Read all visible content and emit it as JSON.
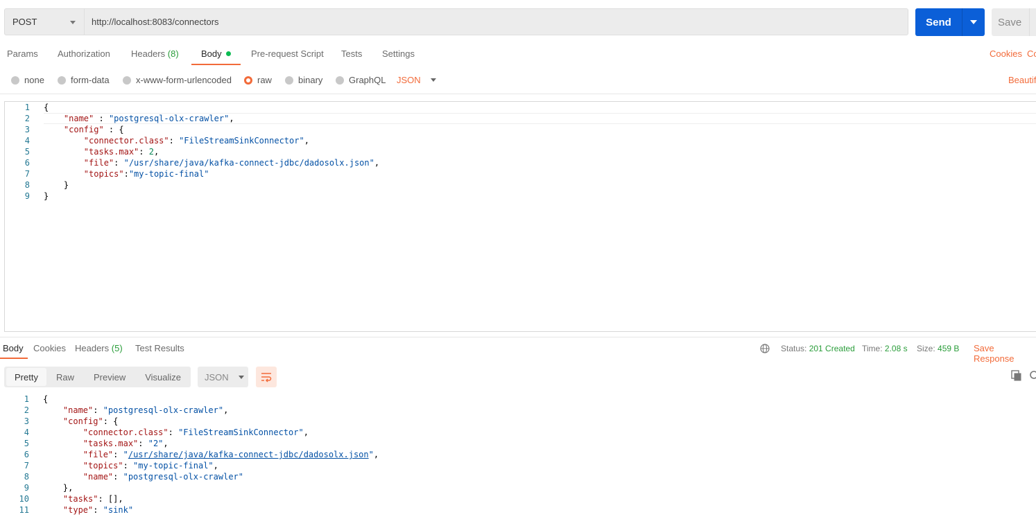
{
  "request": {
    "method": "POST",
    "url": "http://localhost:8083/connectors",
    "send_label": "Send",
    "save_label": "Save"
  },
  "request_tabs": {
    "params": "Params",
    "authorization": "Authorization",
    "headers": "Headers",
    "headers_count": "(8)",
    "body": "Body",
    "prerequest": "Pre-request Script",
    "tests": "Tests",
    "settings": "Settings",
    "cookies_link": "Cookies",
    "code_link": "Co"
  },
  "body_types": {
    "none": "none",
    "form_data": "form-data",
    "urlencoded": "x-www-form-urlencoded",
    "raw": "raw",
    "binary": "binary",
    "graphql": "GraphQL",
    "language": "JSON",
    "beautify": "Beautif"
  },
  "request_body_lines": [
    {
      "n": "1",
      "t": "{"
    },
    {
      "n": "2",
      "t": "    \"name\" : \"postgresql-olx-crawler\","
    },
    {
      "n": "3",
      "t": "    \"config\" : {"
    },
    {
      "n": "4",
      "t": "        \"connector.class\": \"FileStreamSinkConnector\","
    },
    {
      "n": "5",
      "t": "        \"tasks.max\": 2,"
    },
    {
      "n": "6",
      "t": "        \"file\": \"/usr/share/java/kafka-connect-jdbc/dadosolx.json\","
    },
    {
      "n": "7",
      "t": "        \"topics\":\"my-topic-final\""
    },
    {
      "n": "8",
      "t": "    }"
    },
    {
      "n": "9",
      "t": "}"
    }
  ],
  "response_tabs": {
    "body": "Body",
    "cookies": "Cookies",
    "headers": "Headers",
    "headers_count": "(5)",
    "test_results": "Test Results"
  },
  "response_meta": {
    "status_label": "Status:",
    "status_value": "201 Created",
    "time_label": "Time:",
    "time_value": "2.08 s",
    "size_label": "Size:",
    "size_value": "459 B",
    "save_response": "Save Response"
  },
  "response_view": {
    "pretty": "Pretty",
    "raw": "Raw",
    "preview": "Preview",
    "visualize": "Visualize",
    "format": "JSON"
  },
  "response_body_lines": [
    {
      "n": "1",
      "t": "{"
    },
    {
      "n": "2",
      "t": "    \"name\": \"postgresql-olx-crawler\","
    },
    {
      "n": "3",
      "t": "    \"config\": {"
    },
    {
      "n": "4",
      "t": "        \"connector.class\": \"FileStreamSinkConnector\","
    },
    {
      "n": "5",
      "t": "        \"tasks.max\": \"2\","
    },
    {
      "n": "6",
      "t": "        \"file\": \"/usr/share/java/kafka-connect-jdbc/dadosolx.json\","
    },
    {
      "n": "7",
      "t": "        \"topics\": \"my-topic-final\","
    },
    {
      "n": "8",
      "t": "        \"name\": \"postgresql-olx-crawler\""
    },
    {
      "n": "9",
      "t": "    },"
    },
    {
      "n": "10",
      "t": "    \"tasks\": [],"
    },
    {
      "n": "11",
      "t": "    \"type\": \"sink\""
    }
  ],
  "colors": {
    "accent": "#f26b3a",
    "send": "#0b5fd8",
    "success": "#2a9d3a"
  }
}
